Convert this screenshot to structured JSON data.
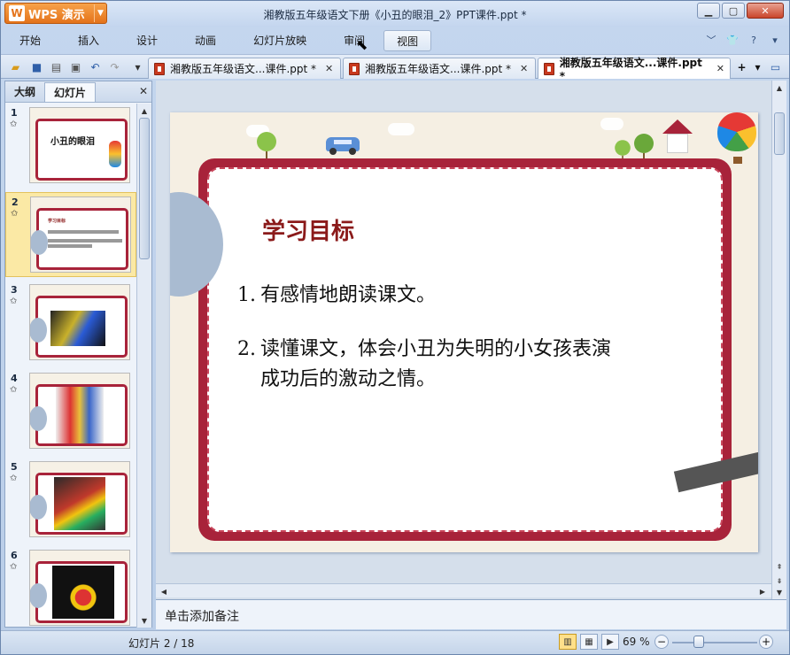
{
  "app": {
    "wps_button_label": "WPS 演示",
    "window_title": "湘教版五年级语文下册《小丑的眼泪_2》PPT课件.ppt *"
  },
  "menu": {
    "items": [
      "开始",
      "插入",
      "设计",
      "动画",
      "幻灯片放映",
      "审阅",
      "视图"
    ],
    "active_index": 6
  },
  "doc_tabs": [
    {
      "label": "湘教版五年级语文...课件.ppt *",
      "active": false
    },
    {
      "label": "湘教版五年级语文...课件.ppt *",
      "active": false
    },
    {
      "label": "湘教版五年级语文...课件.ppt *",
      "active": true
    }
  ],
  "left_panel": {
    "tabs": [
      "大纲",
      "幻灯片"
    ],
    "active_tab": "幻灯片",
    "thumbnails": [
      {
        "num": "1",
        "text": "小丑的眼泪",
        "selected": false
      },
      {
        "num": "2",
        "text": "学习目标",
        "selected": true
      },
      {
        "num": "3",
        "text": "",
        "selected": false
      },
      {
        "num": "4",
        "text": "",
        "selected": false
      },
      {
        "num": "5",
        "text": "",
        "selected": false
      },
      {
        "num": "6",
        "text": "",
        "selected": false
      }
    ]
  },
  "slide": {
    "title": "学习目标",
    "items": [
      {
        "num": "1.",
        "lines": [
          "有感情地朗读课文。"
        ]
      },
      {
        "num": "2.",
        "lines": [
          "读懂课文，体会小丑为失明的小女孩表演",
          "成功后的激动之情。"
        ]
      }
    ]
  },
  "notes_placeholder": "单击添加备注",
  "status": {
    "slide_position": "幻灯片 2 / 18",
    "zoom": "69 %"
  },
  "colors": {
    "accent_orange": "#e4731a",
    "frame_red": "#a8233a",
    "title_color": "#8b1a1a"
  }
}
